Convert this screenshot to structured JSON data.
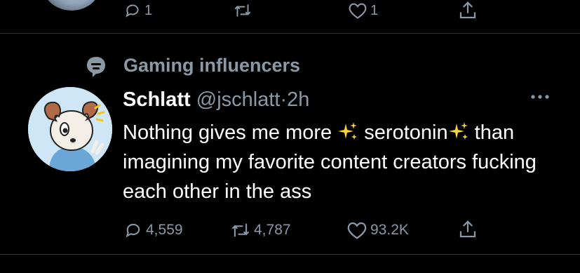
{
  "previous_tweet": {
    "actions": {
      "reply_count": "1",
      "retweet_count": "",
      "like_count": "1"
    }
  },
  "tweet": {
    "context_label": "Gaming influencers",
    "author": {
      "name": "Schlatt",
      "handle": "@jschlatt",
      "separator": "·",
      "time": "2h"
    },
    "text": {
      "part1": "Nothing gives me more ",
      "part2": " serotonin",
      "part3": " than imagining my favorite content creators fucking each other in the ass"
    },
    "actions": {
      "reply_count": "4,559",
      "retweet_count": "4,787",
      "like_count": "93.2K"
    }
  },
  "colors": {
    "background": "#000000",
    "text_primary": "#ffffff",
    "text_secondary": "#8b98a5",
    "divider": "#2f3336",
    "sparkle": "#ffd43b",
    "avatar_bg": "#cfe6f7"
  }
}
